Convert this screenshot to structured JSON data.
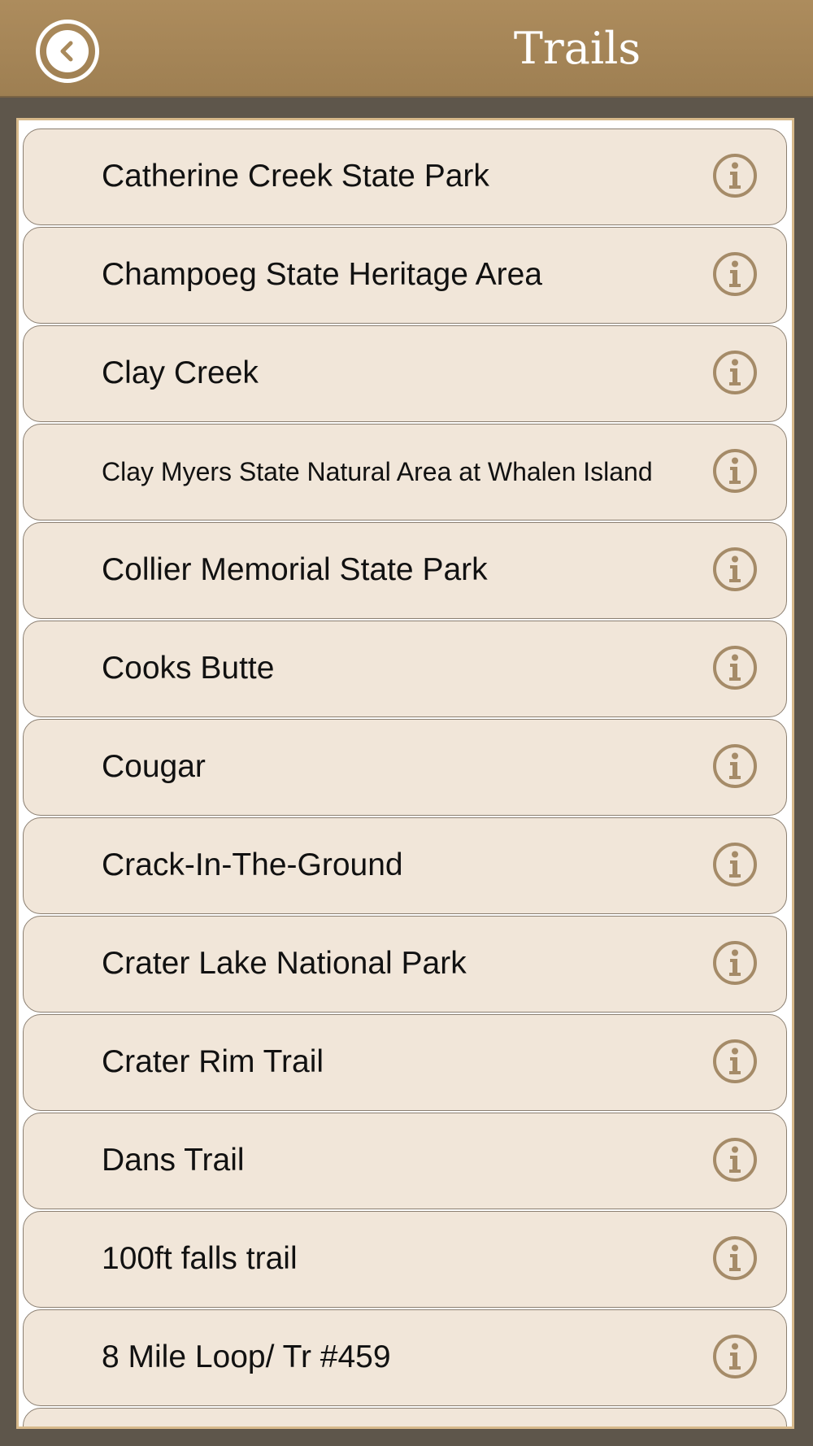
{
  "header": {
    "title": "Trails"
  },
  "icons": {
    "back": "chevron-left-circle-icon",
    "info": "info-circle-icon"
  },
  "colors": {
    "header": "#a98a5c",
    "row_background": "#f1e6d9",
    "icon": "#a58b68",
    "frame_border": "#d7b98b"
  },
  "trails": [
    {
      "label": "Catherine Creek State Park"
    },
    {
      "label": "Champoeg State Heritage Area"
    },
    {
      "label": "Clay Creek"
    },
    {
      "label": "Clay Myers State Natural Area at Whalen Island"
    },
    {
      "label": "Collier Memorial State Park"
    },
    {
      "label": "Cooks Butte"
    },
    {
      "label": "Cougar"
    },
    {
      "label": "Crack-In-The-Ground"
    },
    {
      "label": "Crater Lake National Park"
    },
    {
      "label": "Crater Rim Trail"
    },
    {
      "label": "Dans Trail"
    },
    {
      "label": "100ft falls trail"
    },
    {
      "label": "8 Mile Loop/ Tr #459"
    },
    {
      "label": ""
    }
  ]
}
